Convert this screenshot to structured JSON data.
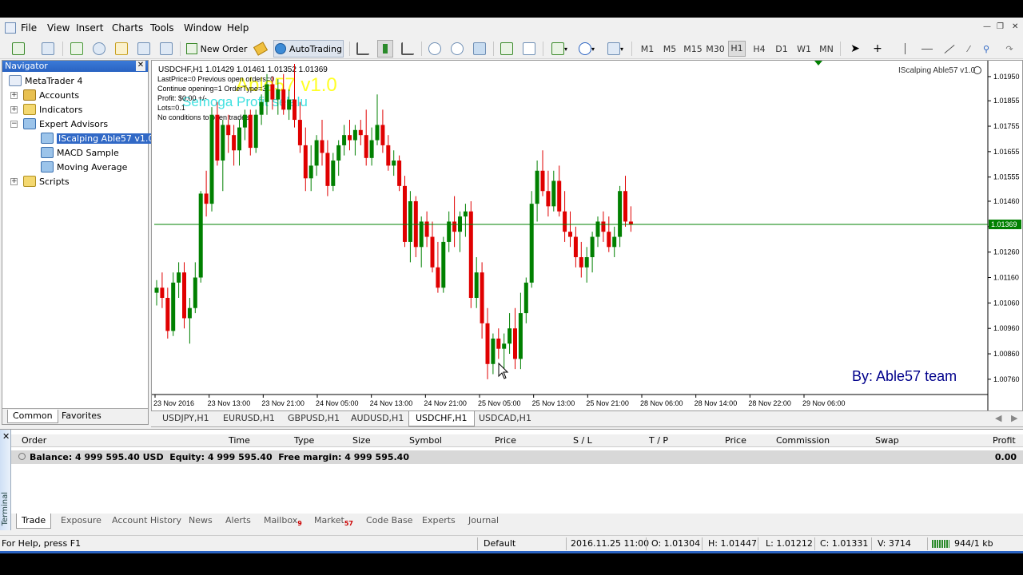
{
  "menu": [
    "File",
    "View",
    "Insert",
    "Charts",
    "Tools",
    "Window",
    "Help"
  ],
  "toolbar": {
    "new_order": "New Order",
    "autotrading": "AutoTrading",
    "timeframes": [
      "M1",
      "M5",
      "M15",
      "M30",
      "H1",
      "H4",
      "D1",
      "W1",
      "MN"
    ],
    "active_timeframe": "H1"
  },
  "navigator": {
    "title": "Navigator",
    "root": "MetaTrader 4",
    "accounts": "Accounts",
    "indicators": "Indicators",
    "expert_advisors": "Expert Advisors",
    "experts": [
      "IScalping Able57 v1.0",
      "MACD Sample",
      "Moving Average"
    ],
    "scripts": "Scripts",
    "tabs": [
      "Common",
      "Favorites"
    ]
  },
  "chart": {
    "header": "USDCHF,H1  1.01429 1.01461 1.01352 1.01369",
    "ea_label": "IScalping Able57 v1.0",
    "overlay_big_1": "Able57 v1.0",
    "overlay_big_2": "Semoga Profit selalu",
    "info_lines": [
      "LastPrice=0 Previous open orders=0",
      "Continue opening=1 OrderType=3",
      "Profit: $0.00 +/-",
      "Lots=0.1",
      "No conditions to open trades"
    ],
    "signature": "By: Able57 team",
    "current_price": "1.01369",
    "colors": {
      "bull": "#008000",
      "bear": "#e00000",
      "line": "#008000",
      "axis": "#000"
    }
  },
  "chart_data": {
    "type": "candlestick",
    "symbol": "USDCHF",
    "timeframe": "H1",
    "ylim": [
      1.007,
      1.02
    ],
    "y_ticks": [
      "1.01950",
      "1.01855",
      "1.01755",
      "1.01655",
      "1.01555",
      "1.01460",
      "1.01360",
      "1.01260",
      "1.01160",
      "1.01060",
      "1.00960",
      "1.00860",
      "1.00760"
    ],
    "x_ticks": [
      "23 Nov 2016",
      "23 Nov 13:00",
      "23 Nov 21:00",
      "24 Nov 05:00",
      "24 Nov 13:00",
      "24 Nov 21:00",
      "25 Nov 05:00",
      "25 Nov 13:00",
      "25 Nov 21:00",
      "28 Nov 06:00",
      "28 Nov 14:00",
      "28 Nov 22:00",
      "29 Nov 06:00"
    ],
    "candles": [
      [
        1.011,
        1.0115,
        1.0105,
        1.0112
      ],
      [
        1.0112,
        1.0118,
        1.0104,
        1.0108
      ],
      [
        1.0108,
        1.0112,
        1.0092,
        1.0095
      ],
      [
        1.0095,
        1.0118,
        1.0093,
        1.0114
      ],
      [
        1.0114,
        1.0122,
        1.0108,
        1.0118
      ],
      [
        1.0118,
        1.0122,
        1.0096,
        1.01
      ],
      [
        1.01,
        1.0108,
        1.009,
        1.0104
      ],
      [
        1.0104,
        1.0122,
        1.0102,
        1.0116
      ],
      [
        1.0116,
        1.015,
        1.0114,
        1.0149
      ],
      [
        1.0149,
        1.0158,
        1.014,
        1.0145
      ],
      [
        1.0145,
        1.0183,
        1.0142,
        1.018
      ],
      [
        1.018,
        1.0185,
        1.016,
        1.0162
      ],
      [
        1.0162,
        1.0178,
        1.015,
        1.0176
      ],
      [
        1.0176,
        1.018,
        1.0165,
        1.0172
      ],
      [
        1.0172,
        1.0176,
        1.016,
        1.0166
      ],
      [
        1.0166,
        1.0178,
        1.016,
        1.0175
      ],
      [
        1.0175,
        1.0182,
        1.017,
        1.018
      ],
      [
        1.018,
        1.0182,
        1.0164,
        1.0167
      ],
      [
        1.0167,
        1.0182,
        1.0165,
        1.018
      ],
      [
        1.018,
        1.0188,
        1.0176,
        1.0185
      ],
      [
        1.0185,
        1.0196,
        1.018,
        1.0192
      ],
      [
        1.0192,
        1.0195,
        1.0182,
        1.0186
      ],
      [
        1.0186,
        1.0194,
        1.018,
        1.019
      ],
      [
        1.019,
        1.0196,
        1.018,
        1.0182
      ],
      [
        1.0182,
        1.019,
        1.0178,
        1.0186
      ],
      [
        1.0186,
        1.02,
        1.0175,
        1.0178
      ],
      [
        1.0178,
        1.0185,
        1.0165,
        1.0168
      ],
      [
        1.0168,
        1.0175,
        1.015,
        1.0155
      ],
      [
        1.0155,
        1.0168,
        1.015,
        1.016
      ],
      [
        1.016,
        1.0172,
        1.0156,
        1.017
      ],
      [
        1.017,
        1.0178,
        1.016,
        1.0165
      ],
      [
        1.0165,
        1.017,
        1.0148,
        1.0152
      ],
      [
        1.0152,
        1.0165,
        1.015,
        1.0162
      ],
      [
        1.0162,
        1.017,
        1.0156,
        1.0168
      ],
      [
        1.0168,
        1.0176,
        1.0164,
        1.0172
      ],
      [
        1.0172,
        1.0178,
        1.0166,
        1.017
      ],
      [
        1.017,
        1.0176,
        1.0164,
        1.0174
      ],
      [
        1.0174,
        1.0178,
        1.0168,
        1.0172
      ],
      [
        1.0172,
        1.0182,
        1.016,
        1.0163
      ],
      [
        1.0163,
        1.0175,
        1.016,
        1.017
      ],
      [
        1.017,
        1.0188,
        1.0168,
        1.0176
      ],
      [
        1.0176,
        1.0182,
        1.0165,
        1.0168
      ],
      [
        1.0168,
        1.0172,
        1.0158,
        1.016
      ],
      [
        1.016,
        1.0166,
        1.0156,
        1.0162
      ],
      [
        1.0162,
        1.0164,
        1.015,
        1.0152
      ],
      [
        1.0152,
        1.0156,
        1.0128,
        1.013
      ],
      [
        1.013,
        1.015,
        1.0122,
        1.0146
      ],
      [
        1.0146,
        1.0148,
        1.0124,
        1.0128
      ],
      [
        1.0128,
        1.014,
        1.012,
        1.0138
      ],
      [
        1.0138,
        1.0142,
        1.0128,
        1.0132
      ],
      [
        1.0132,
        1.0138,
        1.0118,
        1.012
      ],
      [
        1.012,
        1.013,
        1.011,
        1.0112
      ],
      [
        1.0112,
        1.0132,
        1.011,
        1.013
      ],
      [
        1.013,
        1.0142,
        1.0126,
        1.0138
      ],
      [
        1.0138,
        1.0148,
        1.0128,
        1.0134
      ],
      [
        1.0134,
        1.0142,
        1.0126,
        1.014
      ],
      [
        1.014,
        1.0145,
        1.0132,
        1.0142
      ],
      [
        1.0142,
        1.0146,
        1.0104,
        1.0108
      ],
      [
        1.0108,
        1.0124,
        1.0104,
        1.0118
      ],
      [
        1.0118,
        1.0122,
        1.0092,
        1.0098
      ],
      [
        1.0098,
        1.0104,
        1.0076,
        1.0082
      ],
      [
        1.0082,
        1.0094,
        1.0078,
        1.0092
      ],
      [
        1.0092,
        1.0096,
        1.0084,
        1.0088
      ],
      [
        1.0088,
        1.0094,
        1.008,
        1.009
      ],
      [
        1.009,
        1.0102,
        1.0086,
        1.0096
      ],
      [
        1.0096,
        1.0104,
        1.008,
        1.0084
      ],
      [
        1.0084,
        1.011,
        1.008,
        1.0102
      ],
      [
        1.0102,
        1.0116,
        1.0098,
        1.0114
      ],
      [
        1.0114,
        1.015,
        1.0112,
        1.0145
      ],
      [
        1.0145,
        1.0162,
        1.0138,
        1.0158
      ],
      [
        1.0158,
        1.0166,
        1.0148,
        1.015
      ],
      [
        1.015,
        1.0158,
        1.014,
        1.0144
      ],
      [
        1.0144,
        1.0158,
        1.0142,
        1.0154
      ],
      [
        1.0154,
        1.016,
        1.014,
        1.0142
      ],
      [
        1.0142,
        1.015,
        1.013,
        1.0134
      ],
      [
        1.0134,
        1.0142,
        1.0128,
        1.0132
      ],
      [
        1.0132,
        1.0136,
        1.012,
        1.0124
      ],
      [
        1.0124,
        1.013,
        1.0116,
        1.012
      ],
      [
        1.012,
        1.0128,
        1.0114,
        1.0124
      ],
      [
        1.0124,
        1.0134,
        1.0118,
        1.0132
      ],
      [
        1.0132,
        1.014,
        1.0128,
        1.0138
      ],
      [
        1.0138,
        1.0142,
        1.013,
        1.0134
      ],
      [
        1.0134,
        1.014,
        1.0126,
        1.0128
      ],
      [
        1.0128,
        1.0136,
        1.0124,
        1.0132
      ],
      [
        1.0132,
        1.0152,
        1.0128,
        1.015
      ],
      [
        1.015,
        1.0156,
        1.0136,
        1.0138
      ],
      [
        1.0138,
        1.0144,
        1.0134,
        1.0137
      ]
    ]
  },
  "chart_tabs": [
    "USDJPY,H1",
    "EURUSD,H1",
    "GBPUSD,H1",
    "AUDUSD,H1",
    "USDCHF,H1",
    "USDCAD,H1"
  ],
  "active_chart_tab": "USDCHF,H1",
  "terminal": {
    "side_label": "Terminal",
    "columns": [
      "Order",
      "Time",
      "Type",
      "Size",
      "Symbol",
      "Price",
      "S / L",
      "T / P",
      "Price",
      "Commission",
      "Swap",
      "Profit"
    ],
    "balance_line": "Balance: 4 999 595.40 USD  Equity: 4 999 595.40  Free margin: 4 999 595.40",
    "profit_total": "0.00",
    "tabs": [
      "Trade",
      "Exposure",
      "Account History",
      "News",
      "Alerts",
      "Mailbox",
      "Market",
      "Code Base",
      "Experts",
      "Journal"
    ],
    "mailbox_count": "9",
    "market_count": "57"
  },
  "status": {
    "help": "For Help, press F1",
    "profile": "Default",
    "datetime": "2016.11.25 11:00",
    "open": "O: 1.01304",
    "high": "H: 1.01447",
    "low": "L: 1.01212",
    "close": "C: 1.01331",
    "volume": "V: 3714",
    "traffic": "944/1 kb"
  }
}
